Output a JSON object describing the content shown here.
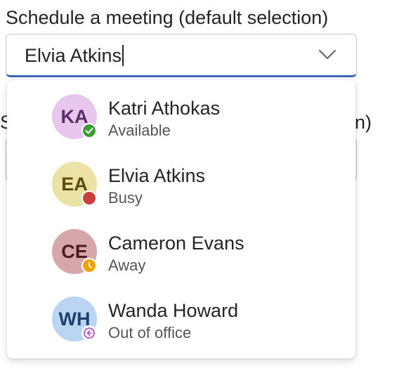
{
  "field_label": "Schedule a meeting (default selection)",
  "combobox": {
    "value": "Elvia Atkins",
    "expand_icon": "chevron-down-icon"
  },
  "second_field": {
    "label_tail": "on)"
  },
  "options": [
    {
      "name": "Katri Athokas",
      "initials": "KA",
      "status": "Available",
      "presence_icon": "checkmark-icon",
      "avatar_bg": "#e7c7ee",
      "avatar_fg": "#5c2e66",
      "presence_color": "#3f9c35"
    },
    {
      "name": "Elvia Atkins",
      "initials": "EA",
      "status": "Busy",
      "presence_icon": "busy-dot-icon",
      "avatar_bg": "#ece2a6",
      "avatar_fg": "#5c4d0f",
      "presence_color": "#cc3e3e"
    },
    {
      "name": "Cameron Evans",
      "initials": "CE",
      "status": "Away",
      "presence_icon": "clock-icon",
      "avatar_bg": "#d6a6ab",
      "avatar_fg": "#4a1c22",
      "presence_color": "#eaa300"
    },
    {
      "name": "Wanda Howard",
      "initials": "WH",
      "status": "Out of office",
      "presence_icon": "arrow-left-icon",
      "avatar_bg": "#b9d5f1",
      "avatar_fg": "#1e3f73",
      "presence_color": "#b34fc2"
    }
  ]
}
